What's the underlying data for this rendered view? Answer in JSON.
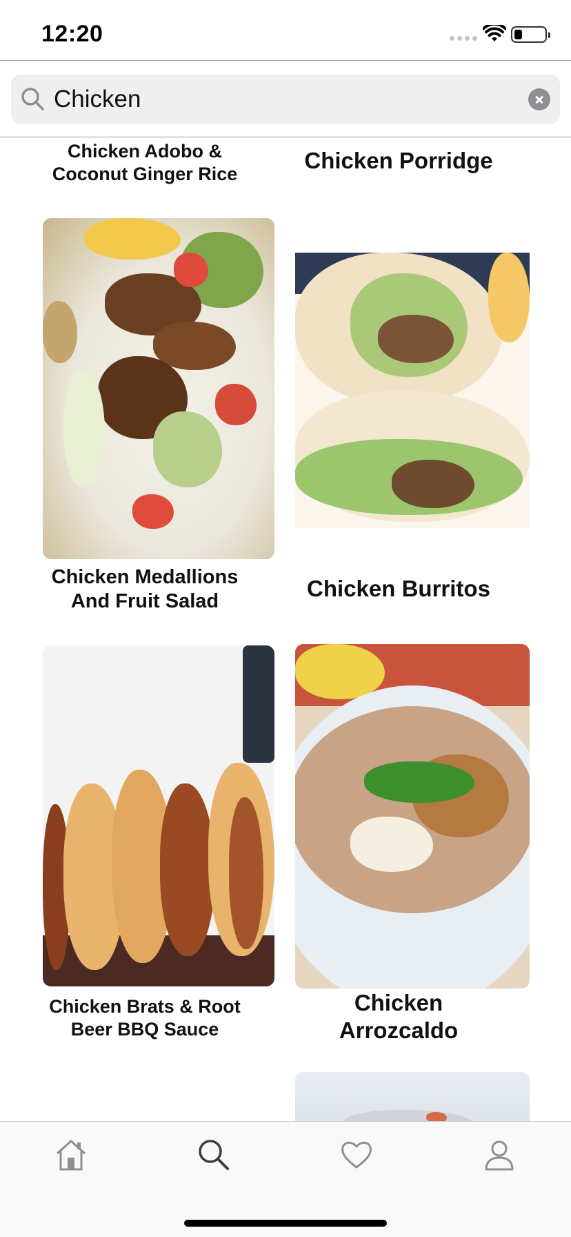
{
  "status_bar": {
    "time": "12:20"
  },
  "search": {
    "value": "Chicken",
    "icon": "search-icon",
    "clear_icon": "clear-icon"
  },
  "recipes": [
    {
      "title": "Chicken Adobo &\nCoconut Ginger Rice"
    },
    {
      "title": "Chicken Porridge"
    },
    {
      "title": "Chicken Medallions\nAnd Fruit Salad"
    },
    {
      "title": "Chicken Burritos"
    },
    {
      "title": "Chicken Brats & Root\nBeer BBQ Sauce"
    },
    {
      "title": "Chicken\nArrozcaldo"
    }
  ],
  "tab_bar": {
    "tabs": [
      {
        "icon": "home-icon",
        "selected": false
      },
      {
        "icon": "search-icon",
        "selected": true
      },
      {
        "icon": "heart-icon",
        "selected": false
      },
      {
        "icon": "profile-icon",
        "selected": false
      }
    ]
  },
  "colors": {
    "search_bg": "#efefef",
    "tab_inactive": "#8e8e93",
    "tab_active": "#3c3c3c",
    "divider": "#9a9a9a"
  }
}
